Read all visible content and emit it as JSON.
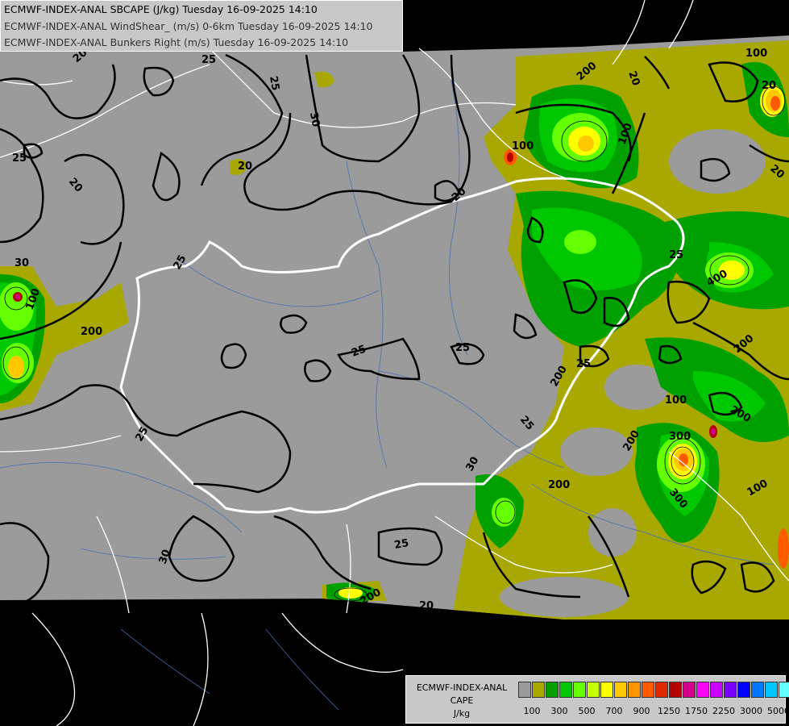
{
  "title_lines": [
    "ECMWF-INDEX-ANAL SBCAPE (J/kg) Tuesday 16-09-2025 14:10",
    "ECMWF-INDEX-ANAL WindShear_ (m/s) 0-6km Tuesday 16-09-2025 14:10",
    "ECMWF-INDEX-ANAL Bunkers Right (m/s) Tuesday 16-09-2025 14:10"
  ],
  "title_colors": [
    "#000000",
    "#333333",
    "#333333"
  ],
  "legend": {
    "line1": "ECMWF-INDEX-ANAL",
    "line2": "CAPE",
    "line3": "J/kg",
    "colors": [
      "#9b9b9b",
      "#a8a800",
      "#00a000",
      "#00c800",
      "#64ff00",
      "#c8ff00",
      "#ffff00",
      "#ffc800",
      "#ff9600",
      "#ff5a00",
      "#e12800",
      "#b40000",
      "#d2008c",
      "#ff00ff",
      "#c800ff",
      "#7800ff",
      "#0000ff",
      "#0078ff",
      "#00c8ff",
      "#64ffff",
      "#ffffff"
    ],
    "tick_labels": [
      "100",
      "300",
      "500",
      "700",
      "900",
      "1250",
      "1750",
      "2250",
      "3000",
      "5000"
    ]
  },
  "contour_labels": [
    "20",
    "25",
    "30",
    "25",
    "30",
    "20",
    "25",
    "25",
    "30",
    "25",
    "20",
    "25",
    "25",
    "20",
    "25",
    "25",
    "20",
    "25",
    "20",
    "30",
    "100",
    "200",
    "100",
    "200",
    "300",
    "400",
    "100",
    "200",
    "300",
    "25",
    "200",
    "200",
    "200",
    "200",
    "100",
    "100",
    "200",
    "400",
    "100",
    "20",
    "20"
  ]
}
